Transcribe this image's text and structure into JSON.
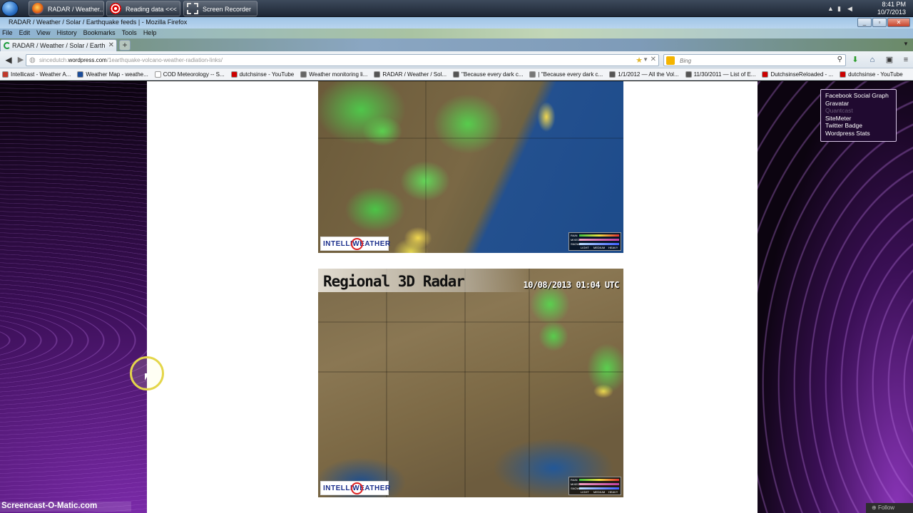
{
  "taskbar": {
    "tasks": [
      {
        "label": "RADAR / Weather..."
      },
      {
        "label": "Reading data <<<"
      },
      {
        "label": "Screen Recorder"
      }
    ],
    "time": "8:41 PM",
    "date": "10/7/2013"
  },
  "window": {
    "title": "RADAR / Weather / Solar / Earthquake feeds | - Mozilla Firefox"
  },
  "menu": [
    "File",
    "Edit",
    "View",
    "History",
    "Bookmarks",
    "Tools",
    "Help"
  ],
  "tab": {
    "label": "RADAR / Weather / Solar / Earthquake fe..."
  },
  "address": {
    "prefix": "sincedutch.",
    "domain": "wordpress.com",
    "path": "/1earthquake-volcano-weather-radiation-links/"
  },
  "search": {
    "placeholder": "Bing"
  },
  "bookmarks": [
    {
      "label": "Intellicast - Weather A...",
      "color": "#c0392b"
    },
    {
      "label": "Weather Map - weathe...",
      "color": "#1a4c99"
    },
    {
      "label": "COD Meteorology -- S...",
      "color": "#ffffff"
    },
    {
      "label": "dutchsinse - YouTube",
      "color": "#cc0000"
    },
    {
      "label": "Weather monitoring li...",
      "color": "#666666"
    },
    {
      "label": "RADAR / Weather / Sol...",
      "color": "#555555"
    },
    {
      "label": "\"Because every dark c...",
      "color": "#555555"
    },
    {
      "label": "| \"Because every dark c...",
      "color": "#777777"
    },
    {
      "label": "1/1/2012 — All the Vol...",
      "color": "#555555"
    },
    {
      "label": "11/30/2011 — List of E...",
      "color": "#555555"
    },
    {
      "label": "DutchsinseReloaded - ...",
      "color": "#cc0000"
    },
    {
      "label": "dutchsinse - YouTube",
      "color": "#cc0000"
    }
  ],
  "radar_top": {
    "logo": "INTELLIWEATHER"
  },
  "radar_bottom": {
    "title": "Regional 3D Radar",
    "timestamp": "10/08/2013  01:04 UTC",
    "logo": "INTELLIWEATHER"
  },
  "legend": {
    "rows": [
      "RAIN",
      "MIXED",
      "SNOW"
    ],
    "scale": [
      "LIGHT",
      "MEDIUM",
      "HEAVY"
    ]
  },
  "widget": {
    "links": [
      "Facebook Social Graph",
      "Gravatar",
      "Quantcast",
      "SiteMeter",
      "Twitter Badge",
      "Wordpress Stats"
    ]
  },
  "follow": {
    "label": "Follow"
  },
  "watermark": {
    "text": "Screencast-O-Matic.com"
  }
}
